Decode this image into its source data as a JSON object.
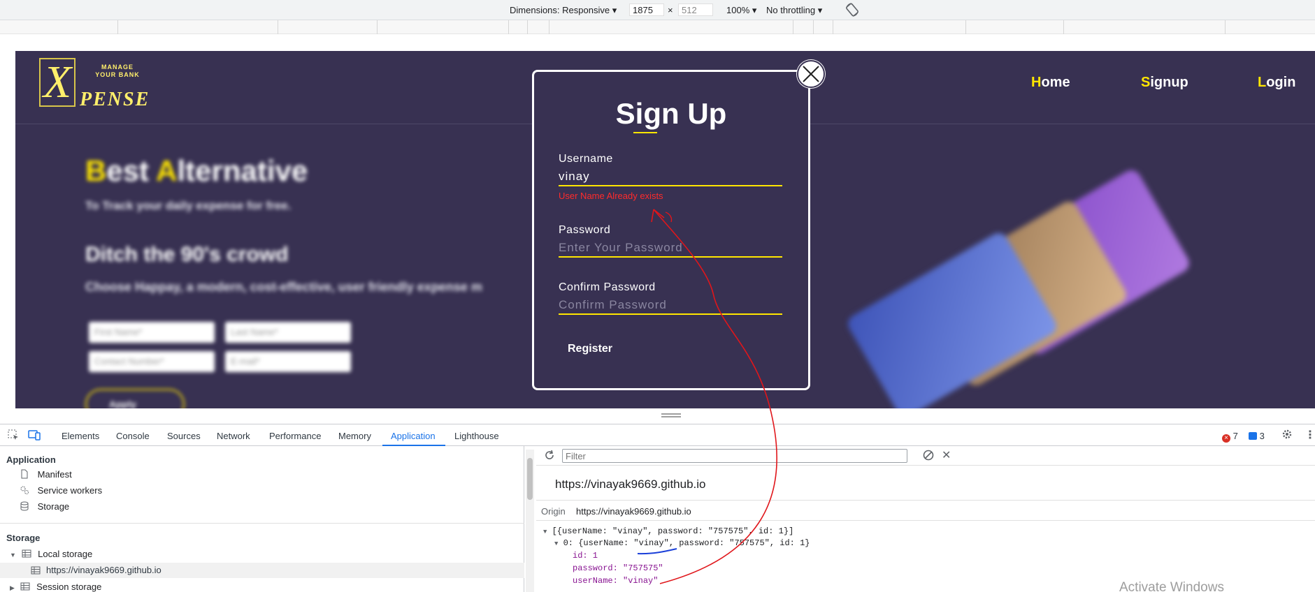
{
  "device_toolbar": {
    "dimensions_label": "Dimensions: Responsive",
    "width": "1875",
    "times": "×",
    "height": "512",
    "zoom": "100%",
    "throttle": "No throttling"
  },
  "site": {
    "logo": {
      "letter": "X",
      "tagline": "MANAGE YOUR BANK",
      "word": "PENSE"
    },
    "nav": [
      {
        "first": "H",
        "rest": "ome"
      },
      {
        "first": "S",
        "rest": "ignup"
      },
      {
        "first": "L",
        "rest": "ogin"
      }
    ],
    "hero": {
      "title_b": "B",
      "title_1": "est ",
      "title_a": "A",
      "title_2": "lternative",
      "subtitle": "To Track your daily expense for free.",
      "heading2": "Ditch the 90's crowd",
      "paragraph": "Choose Happay, a modern, cost-effective, user friendly expense m",
      "inputs": [
        "First Name*",
        "Last Name*",
        "Contact Number*",
        "E-mail*"
      ],
      "apply": "Apply"
    }
  },
  "modal": {
    "title": "Sign Up",
    "username_label": "Username",
    "username_value": "vinay",
    "error": "User Name Already exists",
    "password_label": "Password",
    "password_placeholder": "Enter Your Password",
    "confirm_label": "Confirm Password",
    "confirm_placeholder": "Confirm Password",
    "register": "Register"
  },
  "devtools": {
    "tabs": [
      "Elements",
      "Console",
      "Sources",
      "Network",
      "Performance",
      "Memory",
      "Application",
      "Lighthouse"
    ],
    "active_tab": "Application",
    "errors": "7",
    "messages": "3",
    "sidebar": {
      "application_header": "Application",
      "app_items": [
        "Manifest",
        "Service workers",
        "Storage"
      ],
      "storage_header": "Storage",
      "local_storage": "Local storage",
      "local_origin": "https://vinayak9669.github.io",
      "session_storage": "Session storage"
    },
    "panel": {
      "filter_placeholder": "Filter",
      "origin_title": "https://vinayak9669.github.io",
      "origin_label": "Origin",
      "origin_value": "https://vinayak9669.github.io",
      "json_line1": "[{userName: \"vinay\", password: \"757575\", id: 1}]",
      "json_line2": "0: {userName: \"vinay\", password: \"757575\", id: 1}",
      "id_line": "id: 1",
      "password_line": "password: \"757575\"",
      "username_line": "userName: \"vinay\""
    },
    "watermark": "Activate Windows"
  }
}
